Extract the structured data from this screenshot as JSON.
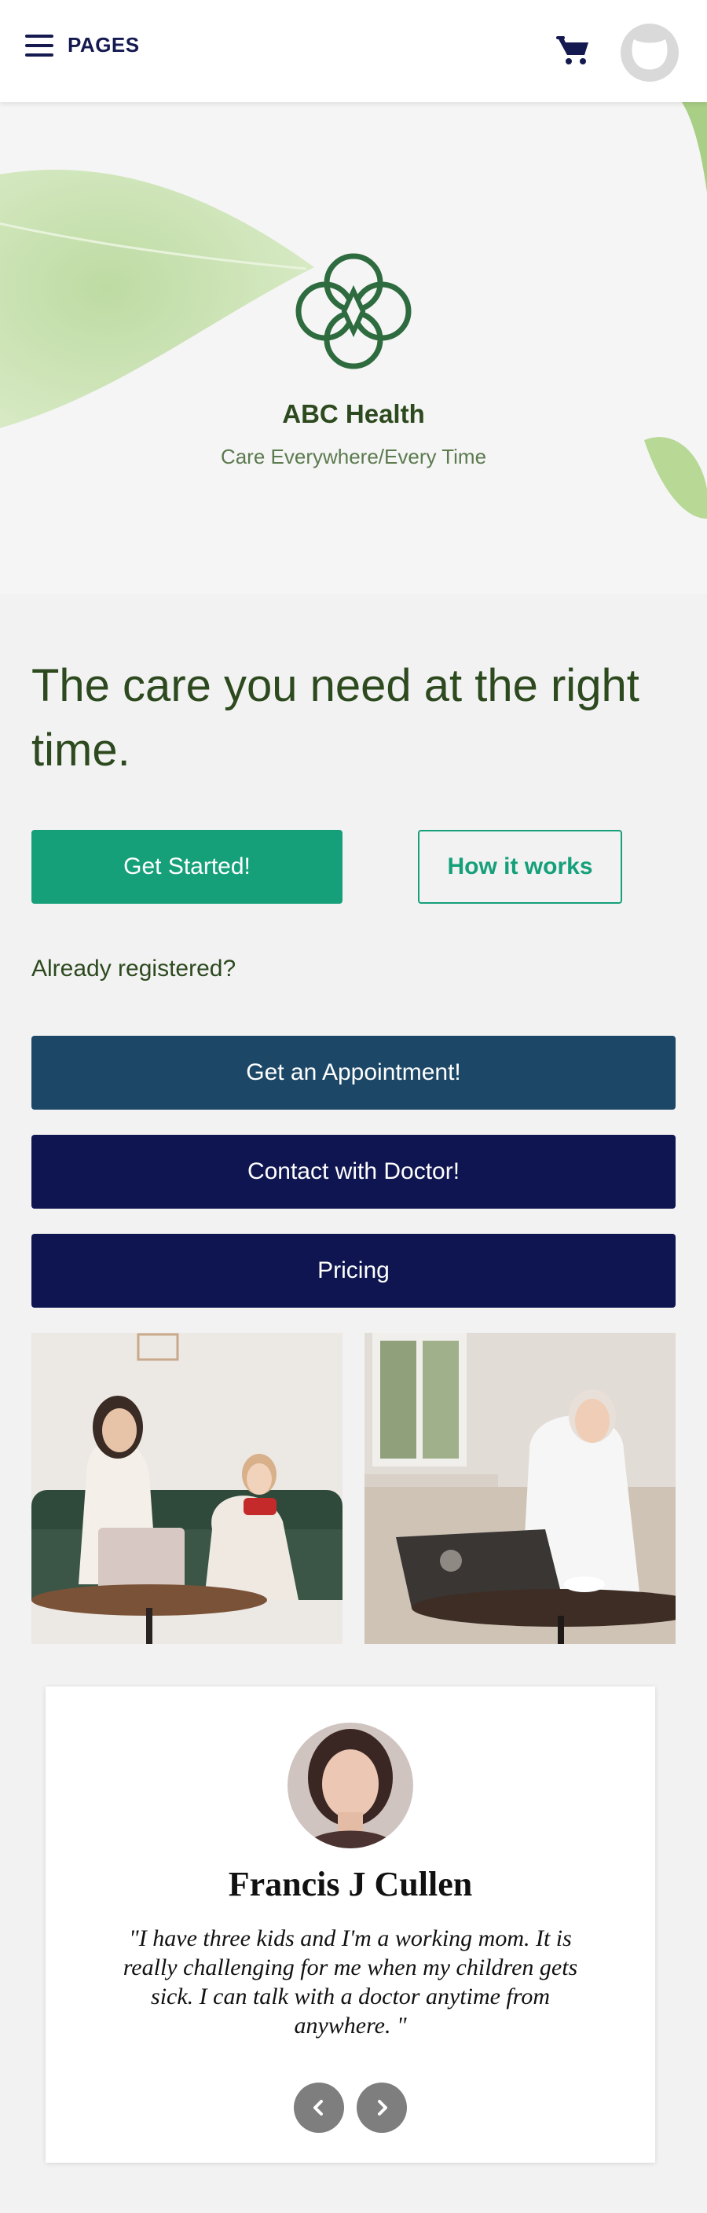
{
  "header": {
    "menu_label": "PAGES",
    "icons": {
      "menu": "hamburger-icon",
      "cart": "cart-icon",
      "user": "avatar-icon"
    }
  },
  "hero": {
    "brand_name": "ABC Health",
    "tagline": "Care Everywhere/Every Time"
  },
  "main": {
    "headline": "The care you need at the right time.",
    "get_started_label": "Get Started!",
    "how_it_works_label": "How it works",
    "registered_text": "Already registered?",
    "appointment_label": "Get an Appointment!",
    "contact_label": "Contact with Doctor!",
    "pricing_label": "Pricing"
  },
  "testimonial": {
    "name": "Francis J Cullen",
    "quote": "\"I have three kids and I'm a working mom. It is really challenging for me when my children gets sick. I can talk with a doctor anytime from anywhere. \""
  },
  "colors": {
    "navy": "#14194f",
    "brand_green": "#2d4a1f",
    "accent_green": "#15a07a",
    "appointment_blue": "#1c4766",
    "dark_navy": "#0f1550",
    "page_bg": "#f2f2f2"
  }
}
